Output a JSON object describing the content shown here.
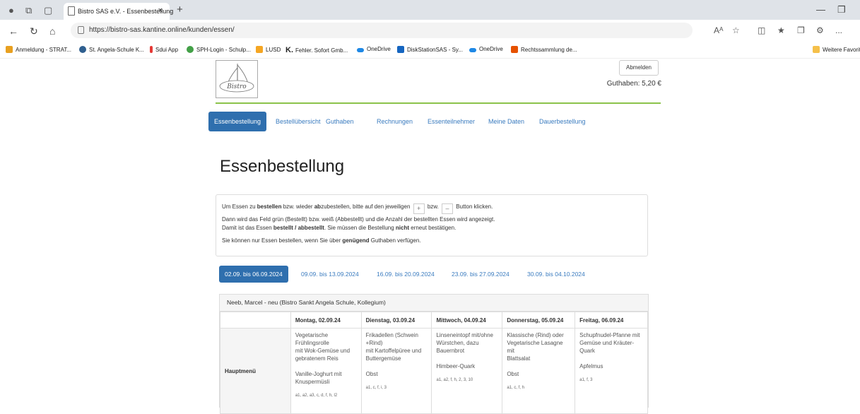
{
  "browser": {
    "tab_title": "Bistro SAS e.V. - Essenbestellung",
    "tab_close": "×",
    "new_tab": "+",
    "url": "https://bistro-sas.kantine.online/kunden/essen/",
    "read_aloud": "Aᴬ",
    "more": "...",
    "bookmarks": [
      {
        "label": "Anmeldung - STRAT...",
        "color": "#e8a020"
      },
      {
        "label": "St. Angela-Schule K...",
        "color": "#2f5f8f"
      },
      {
        "label": "Sdui App",
        "color": "#e53935"
      },
      {
        "label": "SPH-Login - Schulp...",
        "color": "#43a047"
      },
      {
        "label": "LUSD",
        "color": "#f5a623"
      },
      {
        "label": "Fehler. Sofort Gmb...",
        "color": "#222222"
      },
      {
        "label": "OneDrive",
        "color": "#1e88e5"
      },
      {
        "label": "DiskStationSAS - Sy...",
        "color": "#1565c0"
      },
      {
        "label": "OneDrive",
        "color": "#1e88e5"
      },
      {
        "label": "Rechtssammlung de...",
        "color": "#e65100"
      }
    ],
    "other_favorites": "Weitere Favoriten"
  },
  "header": {
    "logout_label": "Abmelden",
    "balance": "Guthaben: 5,20 €"
  },
  "nav": [
    {
      "label": "Essenbestellung",
      "active": true
    },
    {
      "label": "Bestellübersicht"
    },
    {
      "label": "Guthaben"
    },
    {
      "label": "Rechnungen"
    },
    {
      "label": "Essenteilnehmer"
    },
    {
      "label": "Meine Daten"
    },
    {
      "label": "Dauerbestellung"
    }
  ],
  "page_title": "Essenbestellung",
  "info": {
    "l1_a": "Um Essen zu ",
    "l1_b": "bestellen",
    "l1_c": " bzw. wieder ",
    "l1_d": "ab",
    "l1_e": "zubestellen, bitte auf den jeweiligen ",
    "plus": "+",
    "l1_f": " bzw. ",
    "minus": "–",
    "l1_g": " Button klicken.",
    "l2": "Dann wird das Feld grün (Bestellt) bzw. weiß (Abbestellt) und die Anzahl der bestellten Essen wird angezeigt.",
    "l3_a": "Damit ist das Essen ",
    "l3_b": "bestellt / abbestellt",
    "l3_c": ". Sie müssen die Bestellung ",
    "l3_d": "nicht",
    "l3_e": " erneut bestätigen.",
    "l4_a": "Sie können nur Essen bestellen, wenn Sie über ",
    "l4_b": "genügend",
    "l4_c": " Guthaben verfügen."
  },
  "weeks": [
    {
      "label": "02.09. bis 06.09.2024",
      "active": true
    },
    {
      "label": "09.09. bis 13.09.2024"
    },
    {
      "label": "16.09. bis 20.09.2024"
    },
    {
      "label": "23.09. bis 27.09.2024"
    },
    {
      "label": "30.09. bis 04.10.2024"
    }
  ],
  "panel_title": "Neeb, Marcel - neu (Bistro Sankt Angela Schule, Kollegium)",
  "row_label": "Hauptmenü",
  "days": [
    {
      "header": "Montag, 02.09.24",
      "lines": [
        "Vegetarische",
        "Frühlingsrolle",
        "mit Wok-Gemüse und",
        "gebratenem Reis",
        "",
        "Vanille-Joghurt mit",
        "Knuspermüsli"
      ],
      "allergens": "a1, a2, a3, c, d, f, h, l2"
    },
    {
      "header": "Dienstag, 03.09.24",
      "lines": [
        "Frikadellen (Schwein",
        "+Rind)",
        "mit Kartoffelpüree und",
        "Buttergemüse",
        "",
        "Obst"
      ],
      "allergens": "a1, c, f, i, 3"
    },
    {
      "header": "Mittwoch, 04.09.24",
      "lines": [
        "Linseneintopf mit/ohne",
        "Würstchen, dazu",
        "Bauernbrot",
        "",
        "Himbeer-Quark"
      ],
      "allergens": "a1, a2, f, h, 2, 3, 10"
    },
    {
      "header": "Donnerstag, 05.09.24",
      "lines": [
        "Klassische (Rind) oder",
        "Vegetarische Lasagne",
        "mit",
        "Blattsalat",
        "",
        "Obst"
      ],
      "allergens": "a1, c, f, h"
    },
    {
      "header": "Freitag, 06.09.24",
      "lines": [
        "Schupfnudel-Pfanne mit",
        "Gemüse und Kräuter-",
        "Quark",
        "",
        "Apfelmus"
      ],
      "allergens": "a1, f, 3"
    }
  ]
}
